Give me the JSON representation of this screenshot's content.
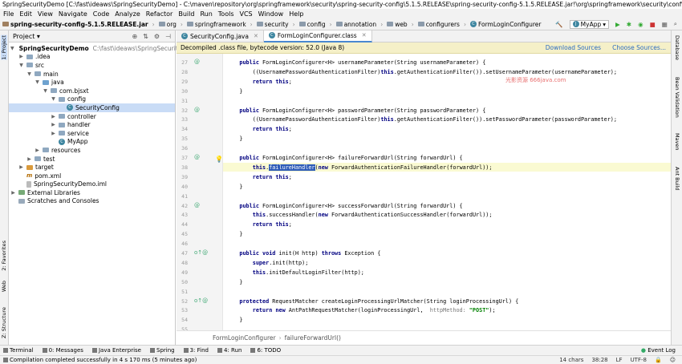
{
  "window": {
    "title": "SpringSecurityDemo [C:\\fast\\ideaws\\SpringSecurityDemo] - C:\\maven\\repository\\org\\springframework\\security\\spring-security-config\\5.1.5.RELEASE\\spring-security-config-5.1.5.RELEASE.jar!\\org\\springframework\\security\\config\\annotation..."
  },
  "menu": [
    "File",
    "Edit",
    "View",
    "Navigate",
    "Code",
    "Analyze",
    "Refactor",
    "Build",
    "Run",
    "Tools",
    "VCS",
    "Window",
    "Help"
  ],
  "breadcrumbs": [
    "spring-security-config-5.1.5.RELEASE.jar",
    "org",
    "springframework",
    "security",
    "config",
    "annotation",
    "web",
    "configurers",
    "FormLoginConfigurer"
  ],
  "run_config": "MyApp",
  "watermark": "光影资源 666java.com",
  "project": {
    "header": "Project",
    "tree": [
      {
        "label": "SpringSecurityDemo",
        "path": "C:\\fast\\ideaws\\SpringSecurityDemo",
        "depth": 0,
        "arrow": "▼",
        "icon": "folder"
      },
      {
        "label": ".idea",
        "depth": 1,
        "arrow": "▶",
        "icon": "folder"
      },
      {
        "label": "src",
        "depth": 1,
        "arrow": "▼",
        "icon": "folder"
      },
      {
        "label": "main",
        "depth": 2,
        "arrow": "▼",
        "icon": "folder"
      },
      {
        "label": "java",
        "depth": 3,
        "arrow": "▼",
        "icon": "src"
      },
      {
        "label": "com.bjsxt",
        "depth": 4,
        "arrow": "▼",
        "icon": "folder"
      },
      {
        "label": "config",
        "depth": 5,
        "arrow": "▼",
        "icon": "folder"
      },
      {
        "label": "SecurityConfig",
        "depth": 6,
        "arrow": "",
        "icon": "class",
        "selected": true
      },
      {
        "label": "controller",
        "depth": 5,
        "arrow": "▶",
        "icon": "folder"
      },
      {
        "label": "handler",
        "depth": 5,
        "arrow": "▶",
        "icon": "folder"
      },
      {
        "label": "service",
        "depth": 5,
        "arrow": "▶",
        "icon": "folder"
      },
      {
        "label": "MyApp",
        "depth": 5,
        "arrow": "",
        "icon": "class"
      },
      {
        "label": "resources",
        "depth": 3,
        "arrow": "▶",
        "icon": "folder"
      },
      {
        "label": "test",
        "depth": 2,
        "arrow": "▶",
        "icon": "folder"
      },
      {
        "label": "target",
        "depth": 1,
        "arrow": "▶",
        "icon": "orange"
      },
      {
        "label": "pom.xml",
        "depth": 1,
        "arrow": "",
        "icon": "maven"
      },
      {
        "label": "SpringSecurityDemo.iml",
        "depth": 1,
        "arrow": "",
        "icon": "file"
      },
      {
        "label": "External Libraries",
        "depth": 0,
        "arrow": "▶",
        "icon": "lib"
      },
      {
        "label": "Scratches and Consoles",
        "depth": 0,
        "arrow": "",
        "icon": "scratch"
      }
    ]
  },
  "tabs": [
    {
      "label": "SecurityConfig.java",
      "active": false
    },
    {
      "label": "FormLoginConfigurer.class",
      "active": true
    }
  ],
  "banner": {
    "text": "Decompiled .class file, bytecode version: 52.0 (Java 8)",
    "download": "Download Sources",
    "choose": "Choose Sources..."
  },
  "code_lines": [
    {
      "n": "27",
      "mark": "@",
      "html": "    <span class=\"kw\">public</span> FormLoginConfigurer&lt;H&gt; usernameParameter(String usernameParameter) {"
    },
    {
      "n": "28",
      "mark": "",
      "html": "        ((UsernamePasswordAuthenticationFilter)<span class=\"kw\">this</span>.getAuthenticationFilter()).setUsernameParameter(usernameParameter);"
    },
    {
      "n": "29",
      "mark": "",
      "html": "        <span class=\"kw\">return this</span>;"
    },
    {
      "n": "30",
      "mark": "",
      "html": "    }"
    },
    {
      "n": "31",
      "mark": "",
      "html": ""
    },
    {
      "n": "32",
      "mark": "@",
      "html": "    <span class=\"kw\">public</span> FormLoginConfigurer&lt;H&gt; passwordParameter(String passwordParameter) {"
    },
    {
      "n": "33",
      "mark": "",
      "html": "        ((UsernamePasswordAuthenticationFilter)<span class=\"kw\">this</span>.getAuthenticationFilter()).setPasswordParameter(passwordParameter);"
    },
    {
      "n": "34",
      "mark": "",
      "html": "        <span class=\"kw\">return this</span>;"
    },
    {
      "n": "35",
      "mark": "",
      "html": "    }"
    },
    {
      "n": "36",
      "mark": "",
      "html": ""
    },
    {
      "n": "37",
      "mark": "@",
      "html": "    <span class=\"kw\">public</span> FormLoginConfigurer&lt;H&gt; failureForwardUrl(String forwardUrl) {"
    },
    {
      "n": "38",
      "mark": "",
      "html": "        <span class=\"kw\">this</span>.<span class=\"hl\">failureHandler</span>(<span class=\"kw\">new</span> ForwardAuthenticationFailureHandler(forwardUrl));"
    },
    {
      "n": "39",
      "mark": "",
      "html": "        <span class=\"kw\">return this</span>;"
    },
    {
      "n": "40",
      "mark": "",
      "html": "    }"
    },
    {
      "n": "41",
      "mark": "",
      "html": ""
    },
    {
      "n": "42",
      "mark": "@",
      "html": "    <span class=\"kw\">public</span> FormLoginConfigurer&lt;H&gt; successForwardUrl(String forwardUrl) {"
    },
    {
      "n": "43",
      "mark": "",
      "html": "        <span class=\"kw\">this</span>.successHandler(<span class=\"kw\">new</span> ForwardAuthenticationSuccessHandler(forwardUrl));"
    },
    {
      "n": "44",
      "mark": "",
      "html": "        <span class=\"kw\">return this</span>;"
    },
    {
      "n": "45",
      "mark": "",
      "html": "    }"
    },
    {
      "n": "46",
      "mark": "",
      "html": ""
    },
    {
      "n": "47",
      "mark": "o↑@",
      "html": "    <span class=\"kw\">public void</span> init(H http) <span class=\"kw\">throws</span> Exception {"
    },
    {
      "n": "48",
      "mark": "",
      "html": "        <span class=\"kw\">super</span>.init(http);"
    },
    {
      "n": "49",
      "mark": "",
      "html": "        <span class=\"kw\">this</span>.initDefaultLoginFilter(http);"
    },
    {
      "n": "50",
      "mark": "",
      "html": "    }"
    },
    {
      "n": "51",
      "mark": "",
      "html": ""
    },
    {
      "n": "52",
      "mark": "o↑@",
      "html": "    <span class=\"kw\">protected</span> RequestMatcher createLoginProcessingUrlMatcher(String loginProcessingUrl) {"
    },
    {
      "n": "53",
      "mark": "",
      "html": "        <span class=\"kw\">return new</span> AntPathRequestMatcher(loginProcessingUrl, <span class=\"hint\"> httpMethod: </span><span class=\"str\">\"POST\"</span>);"
    },
    {
      "n": "54",
      "mark": "",
      "html": "    }"
    },
    {
      "n": "55",
      "mark": "",
      "html": ""
    }
  ],
  "editor_crumbs": [
    "FormLoginConfigurer",
    "failureForwardUrl()"
  ],
  "left_tool_tabs": [
    "1: Project",
    "2: Favorites",
    "Web",
    "Z: Structure"
  ],
  "right_tool_tabs": [
    "Database",
    "Bean Validation",
    "Maven",
    "Ant Build"
  ],
  "bottom_tabs": [
    "Terminal",
    "0: Messages",
    "Java Enterprise",
    "Spring",
    "3: Find",
    "4: Run",
    "6: TODO"
  ],
  "event_log": "Event Log",
  "status": {
    "message": "Compilation completed successfully in 4 s 170 ms (5 minutes ago)",
    "chars": "14 chars",
    "pos": "38:28",
    "line_sep": "LF",
    "encoding": "UTF-8"
  }
}
